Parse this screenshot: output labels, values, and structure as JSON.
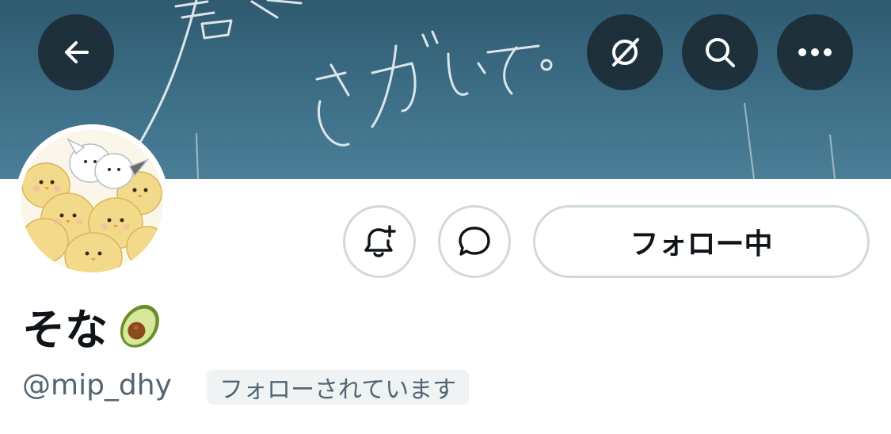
{
  "header": {
    "back_icon": "arrow-left-icon",
    "grok_icon": "grok-icon",
    "search_icon": "search-icon",
    "more_icon": "more-horizontal-icon"
  },
  "banner": {
    "description_icon": "handwritten-banner-image"
  },
  "profile": {
    "avatar_icon": "chick-illustration-avatar",
    "display_name": "そな",
    "name_emoji": "avocado-emoji",
    "handle": "@mip_dhy",
    "follows_you_label": "フォローされています"
  },
  "actions": {
    "notify_icon": "bell-plus-icon",
    "message_icon": "message-bubble-icon",
    "follow_label": "フォロー中"
  },
  "colors": {
    "text_primary": "#0f1419",
    "text_secondary": "#536471",
    "border": "#cfd9de",
    "overlay_button": "#18252c",
    "badge_bg": "#eff3f4"
  }
}
